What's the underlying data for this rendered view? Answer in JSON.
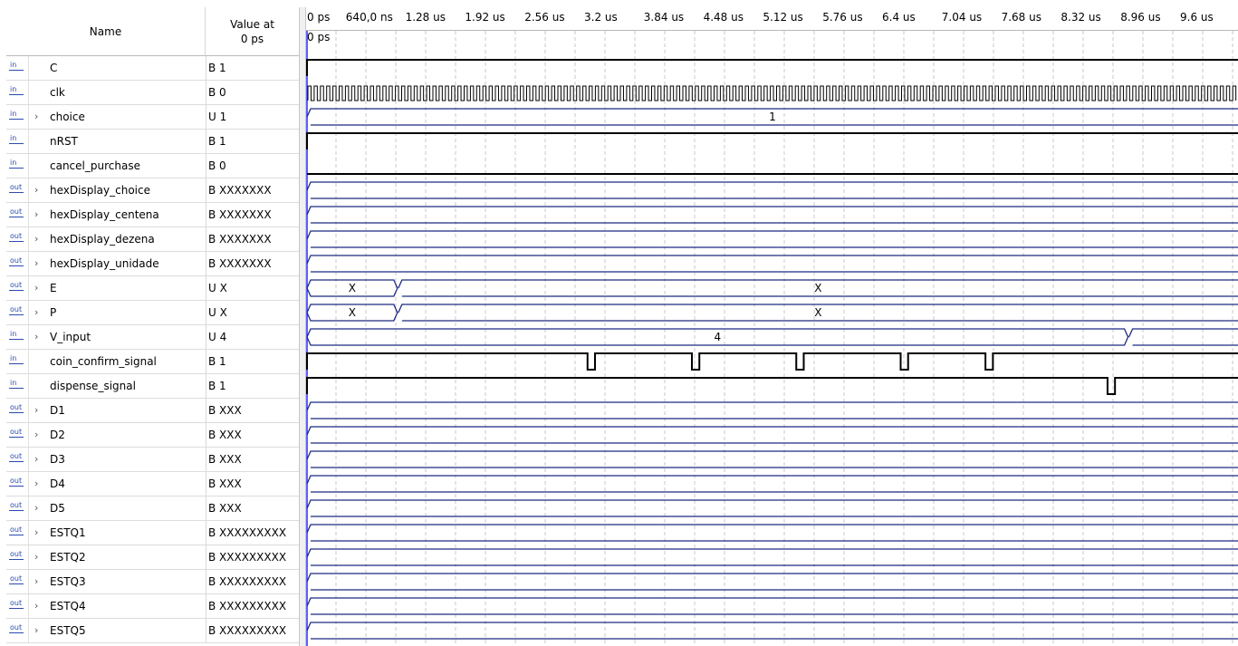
{
  "header": {
    "name_label": "Name",
    "value_label_line1": "Value at",
    "value_label_line2": "0 ps"
  },
  "timescale": {
    "ticks": [
      "0 ps",
      "640,0 ns",
      "1.28 us",
      "1.92 us",
      "2.56 us",
      "3.2 us",
      "3.84 us",
      "4.48 us",
      "5.12 us",
      "5.76 us",
      "6.4 us",
      "7.04 us",
      "7.68 us",
      "8.32 us",
      "8.96 us",
      "9.6 us"
    ],
    "cursor_label": "0 ps"
  },
  "signals": [
    {
      "dir": "in",
      "name": "C",
      "value": "B 1",
      "bus": false,
      "wave": "high"
    },
    {
      "dir": "in",
      "name": "clk",
      "value": "B 0",
      "bus": false,
      "wave": "clock"
    },
    {
      "dir": "in",
      "name": "choice",
      "value": "U 1",
      "bus": true,
      "wave": "bus",
      "segments": [
        {
          "from_us": 0,
          "to_us": 10,
          "label": "1"
        }
      ]
    },
    {
      "dir": "in",
      "name": "nRST",
      "value": "B 1",
      "bus": false,
      "wave": "high"
    },
    {
      "dir": "in",
      "name": "cancel_purchase",
      "value": "B 0",
      "bus": false,
      "wave": "low"
    },
    {
      "dir": "out",
      "name": "hexDisplay_choice",
      "value": "B XXXXXXX",
      "bus": true,
      "wave": "bus",
      "segments": [
        {
          "from_us": 0,
          "to_us": 10,
          "label": ""
        }
      ]
    },
    {
      "dir": "out",
      "name": "hexDisplay_centena",
      "value": "B XXXXXXX",
      "bus": true,
      "wave": "bus",
      "segments": [
        {
          "from_us": 0,
          "to_us": 10,
          "label": ""
        }
      ]
    },
    {
      "dir": "out",
      "name": "hexDisplay_dezena",
      "value": "B XXXXXXX",
      "bus": true,
      "wave": "bus",
      "segments": [
        {
          "from_us": 0,
          "to_us": 10,
          "label": ""
        }
      ]
    },
    {
      "dir": "out",
      "name": "hexDisplay_unidade",
      "value": "B XXXXXXX",
      "bus": true,
      "wave": "bus",
      "segments": [
        {
          "from_us": 0,
          "to_us": 10,
          "label": ""
        }
      ]
    },
    {
      "dir": "out",
      "name": "E",
      "value": "U X",
      "bus": true,
      "wave": "bus",
      "segments": [
        {
          "from_us": 0,
          "to_us": 0.98,
          "label": "X"
        },
        {
          "from_us": 0.98,
          "to_us": 10,
          "label": "X"
        }
      ]
    },
    {
      "dir": "out",
      "name": "P",
      "value": "U X",
      "bus": true,
      "wave": "bus",
      "segments": [
        {
          "from_us": 0,
          "to_us": 0.98,
          "label": "X"
        },
        {
          "from_us": 0.98,
          "to_us": 10,
          "label": "X"
        }
      ]
    },
    {
      "dir": "in",
      "name": "V_input",
      "value": "U 4",
      "bus": true,
      "wave": "bus",
      "segments": [
        {
          "from_us": 0,
          "to_us": 8.82,
          "label": "4"
        },
        {
          "from_us": 8.82,
          "to_us": 10,
          "label": ""
        }
      ]
    },
    {
      "dir": "in",
      "name": "coin_confirm_signal",
      "value": "B 1",
      "bus": false,
      "wave": "high_pulses",
      "pulses_us": [
        [
          3.02,
          3.1
        ],
        [
          4.14,
          4.22
        ],
        [
          5.26,
          5.34
        ],
        [
          6.38,
          6.46
        ],
        [
          7.29,
          7.37
        ]
      ]
    },
    {
      "dir": "in",
      "name": "dispense_signal",
      "value": "B 1",
      "bus": false,
      "wave": "high_pulses",
      "pulses_us": [
        [
          8.6,
          8.68
        ]
      ]
    },
    {
      "dir": "out",
      "name": "D1",
      "value": "B XXX",
      "bus": true,
      "wave": "bus",
      "segments": [
        {
          "from_us": 0,
          "to_us": 10,
          "label": ""
        }
      ]
    },
    {
      "dir": "out",
      "name": "D2",
      "value": "B XXX",
      "bus": true,
      "wave": "bus",
      "segments": [
        {
          "from_us": 0,
          "to_us": 10,
          "label": ""
        }
      ]
    },
    {
      "dir": "out",
      "name": "D3",
      "value": "B XXX",
      "bus": true,
      "wave": "bus",
      "segments": [
        {
          "from_us": 0,
          "to_us": 10,
          "label": ""
        }
      ]
    },
    {
      "dir": "out",
      "name": "D4",
      "value": "B XXX",
      "bus": true,
      "wave": "bus",
      "segments": [
        {
          "from_us": 0,
          "to_us": 10,
          "label": ""
        }
      ]
    },
    {
      "dir": "out",
      "name": "D5",
      "value": "B XXX",
      "bus": true,
      "wave": "bus",
      "segments": [
        {
          "from_us": 0,
          "to_us": 10,
          "label": ""
        }
      ]
    },
    {
      "dir": "out",
      "name": "ESTQ1",
      "value": "B XXXXXXXXX",
      "bus": true,
      "wave": "bus",
      "segments": [
        {
          "from_us": 0,
          "to_us": 10,
          "label": ""
        }
      ]
    },
    {
      "dir": "out",
      "name": "ESTQ2",
      "value": "B XXXXXXXXX",
      "bus": true,
      "wave": "bus",
      "segments": [
        {
          "from_us": 0,
          "to_us": 10,
          "label": ""
        }
      ]
    },
    {
      "dir": "out",
      "name": "ESTQ3",
      "value": "B XXXXXXXXX",
      "bus": true,
      "wave": "bus",
      "segments": [
        {
          "from_us": 0,
          "to_us": 10,
          "label": ""
        }
      ]
    },
    {
      "dir": "out",
      "name": "ESTQ4",
      "value": "B XXXXXXXXX",
      "bus": true,
      "wave": "bus",
      "segments": [
        {
          "from_us": 0,
          "to_us": 10,
          "label": ""
        }
      ]
    },
    {
      "dir": "out",
      "name": "ESTQ5",
      "value": "B XXXXXXXXX",
      "bus": true,
      "wave": "bus",
      "segments": [
        {
          "from_us": 0,
          "to_us": 10,
          "label": ""
        }
      ]
    }
  ],
  "colors": {
    "bus": "#1c2a80",
    "binary": "#000000",
    "grid": "#c8c8c8",
    "cursor": "#2a2aff"
  }
}
